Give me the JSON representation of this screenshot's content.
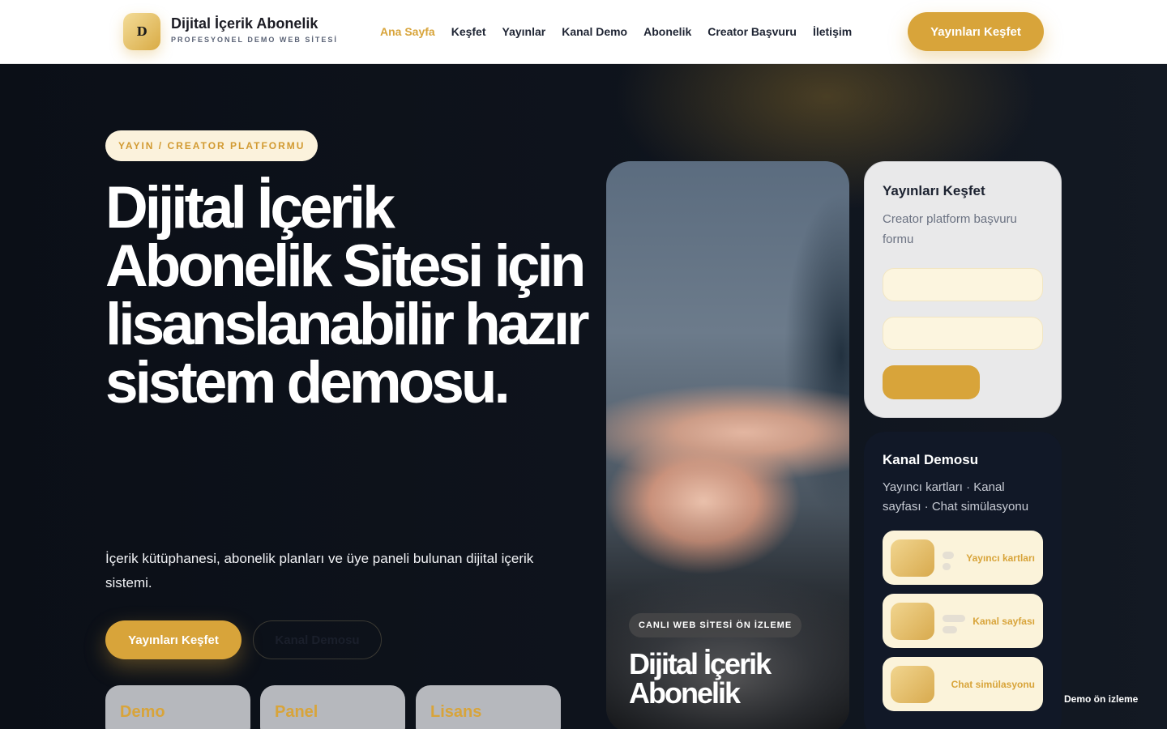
{
  "header": {
    "logo_letter": "D",
    "brand_title": "Dijital İçerik Abonelik",
    "brand_subtitle": "PROFESYONEL DEMO WEB SİTESİ",
    "nav": [
      "Ana Sayfa",
      "Keşfet",
      "Yayınlar",
      "Kanal Demo",
      "Abonelik",
      "Creator Başvuru",
      "İletişim"
    ],
    "active_nav": "Ana Sayfa",
    "cta_label": "Yayınları Keşfet"
  },
  "hero": {
    "pill": "YAYIN / CREATOR PLATFORMU",
    "title": "Dijital İçerik Abonelik Sitesi için lisanslanabilir hazır sistem demosu.",
    "description": "İçerik kütüphanesi, abonelik planları ve üye paneli bulunan dijital içerik sistemi.",
    "primary_button": "Yayınları Keşfet",
    "secondary_button": "Kanal Demosu",
    "stat_cards": [
      "Demo",
      "Panel",
      "Lisans"
    ]
  },
  "preview_card": {
    "badge": "CANLI WEB SİTESİ ÖN İZLEME",
    "title": "Dijital İçerik Abonelik"
  },
  "form_card": {
    "title": "Yayınları Keşfet",
    "subtitle": "Creator platform başvuru formu"
  },
  "channel_card": {
    "title": "Kanal Demosu",
    "subtitle": "Yayıncı kartları · Kanal sayfası · Chat simülasyonu",
    "items": [
      "Yayıncı kartları",
      "Kanal sayfası",
      "Chat simülasyonu"
    ]
  },
  "corner_note": "Demo ön izleme",
  "colors": {
    "accent": "#d8a43a",
    "dark_bg": "#0b0f17",
    "card_dark": "#111827",
    "cream": "#fcf5df"
  }
}
